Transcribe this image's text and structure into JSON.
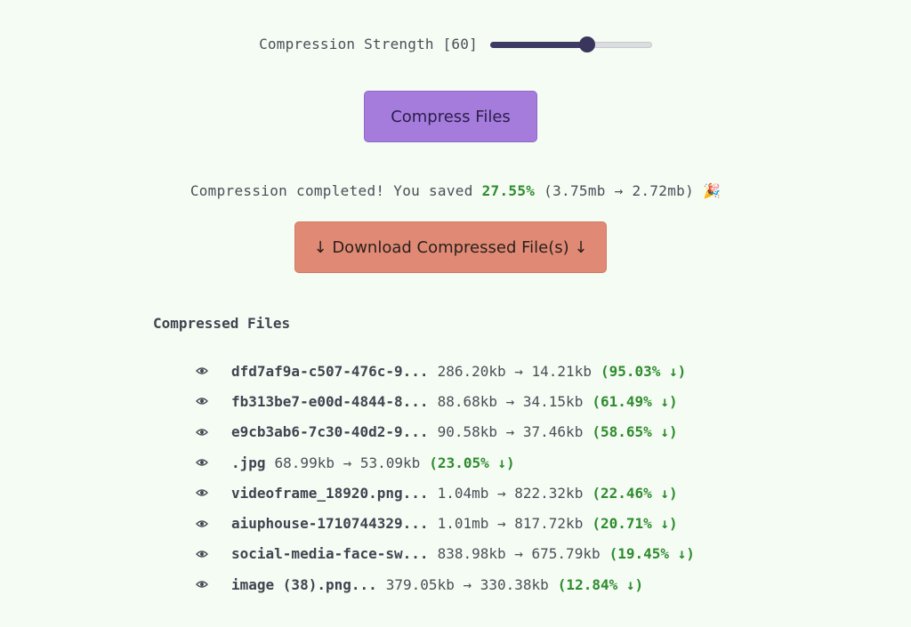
{
  "compression": {
    "label": "Compression Strength [60]",
    "value": 60,
    "max": 100
  },
  "compress_button": "Compress Files",
  "status": {
    "prefix": "Compression completed! You saved ",
    "percent": "27.55%",
    "suffix": " (3.75mb → 2.72mb) ",
    "emoji": "🎉"
  },
  "download_button": "↓ Download Compressed File(s) ↓",
  "files_heading": "Compressed Files",
  "colors": {
    "accent_purple": "#a57bdc",
    "accent_salmon": "#e08a75",
    "success_green": "#2e8b2e",
    "background": "#f4fcf3"
  },
  "files": [
    {
      "name": "dfd7af9a-c507-476c-9...",
      "sizes": "286.20kb → 14.21kb",
      "saving": "(95.03% ↓)",
      "icon": "eye-icon"
    },
    {
      "name": "fb313be7-e00d-4844-8...",
      "sizes": "88.68kb → 34.15kb",
      "saving": "(61.49% ↓)",
      "icon": "eye-icon"
    },
    {
      "name": "e9cb3ab6-7c30-40d2-9...",
      "sizes": "90.58kb → 37.46kb",
      "saving": "(58.65% ↓)",
      "icon": "eye-icon"
    },
    {
      "name": ".jpg",
      "sizes": "68.99kb → 53.09kb",
      "saving": "(23.05% ↓)",
      "icon": "eye-icon"
    },
    {
      "name": "videoframe_18920.png...",
      "sizes": "1.04mb → 822.32kb",
      "saving": "(22.46% ↓)",
      "icon": "eye-icon"
    },
    {
      "name": "aiuphouse-1710744329...",
      "sizes": "1.01mb → 817.72kb",
      "saving": "(20.71% ↓)",
      "icon": "eye-icon"
    },
    {
      "name": "social-media-face-sw...",
      "sizes": "838.98kb → 675.79kb",
      "saving": "(19.45% ↓)",
      "icon": "eye-icon"
    },
    {
      "name": "image (38).png...",
      "sizes": "379.05kb → 330.38kb",
      "saving": "(12.84% ↓)",
      "icon": "eye-icon"
    }
  ]
}
